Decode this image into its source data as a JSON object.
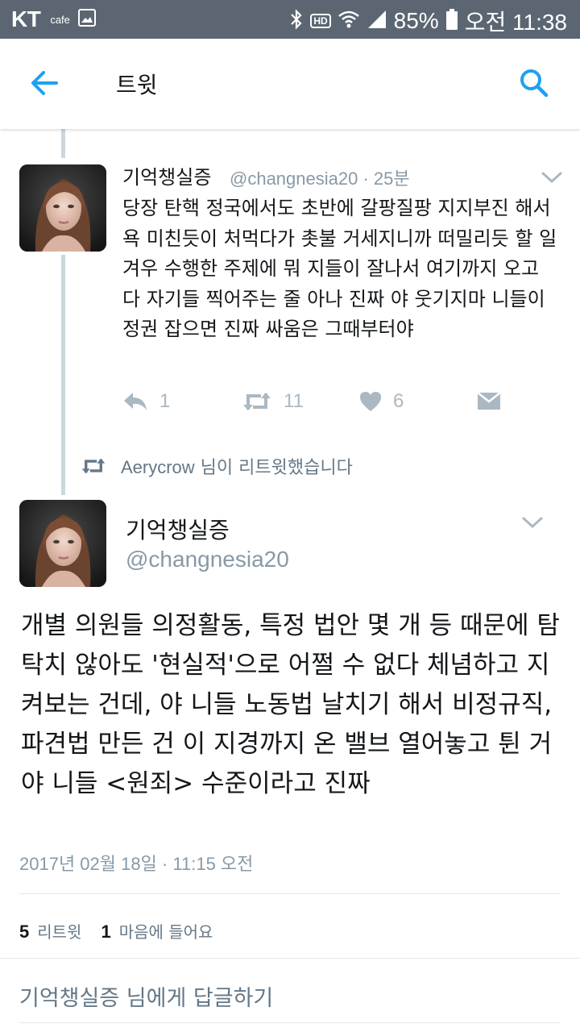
{
  "status_bar": {
    "carrier": "KT",
    "app_label": "cafe",
    "hd_label": "HD",
    "battery": "85%",
    "time": "오전 11:38"
  },
  "header": {
    "title": "트윗"
  },
  "tweet_reply": {
    "name": "기억챙실증",
    "handle": "@changnesia20",
    "time_ago": "· 25분",
    "body": "당장 탄핵 정국에서도 초반에 갈팡질팡 지지부진 해서 욕 미친듯이 처먹다가 촛불 거세지니까 떠밀리듯 할 일 겨우 수행한 주제에 뭐 지들이 잘나서 여기까지 오고 다 자기들 찍어주는 줄 아나 진짜 야 웃기지마 니들이 정권 잡으면 진짜 싸움은 그때부터야",
    "reply_count": "1",
    "retweet_count": "11",
    "like_count": "6"
  },
  "retweet_context": {
    "user": "Aerycrow",
    "suffix": " 님이 리트윗했습니다"
  },
  "main_tweet": {
    "name": "기억챙실증",
    "handle": "@changnesia20",
    "body": "개별 의원들 의정활동, 특정 법안 몇 개 등 때문에 탐탁치 않아도 '현실적'으로 어쩔 수 없다 체념하고 지켜보는 건데, 야 니들 노동법 날치기 해서 비정규직, 파견법 만든 건 이 지경까지 온 밸브 열어놓고 튄 거야 니들 <원죄> 수준이라고 진짜",
    "date": "2017년 02월 18일 · 11:15 오전"
  },
  "stats": {
    "retweets_num": "5",
    "retweets_label": "리트윗",
    "likes_num": "1",
    "likes_label": "마음에 들어요"
  },
  "reply_box": {
    "placeholder": "기억챙실증 님에게 답글하기"
  },
  "colors": {
    "accent": "#1da1f2",
    "status_bar": "#5b6672",
    "muted": "#8899a6",
    "action_icon": "#aab8c2"
  }
}
